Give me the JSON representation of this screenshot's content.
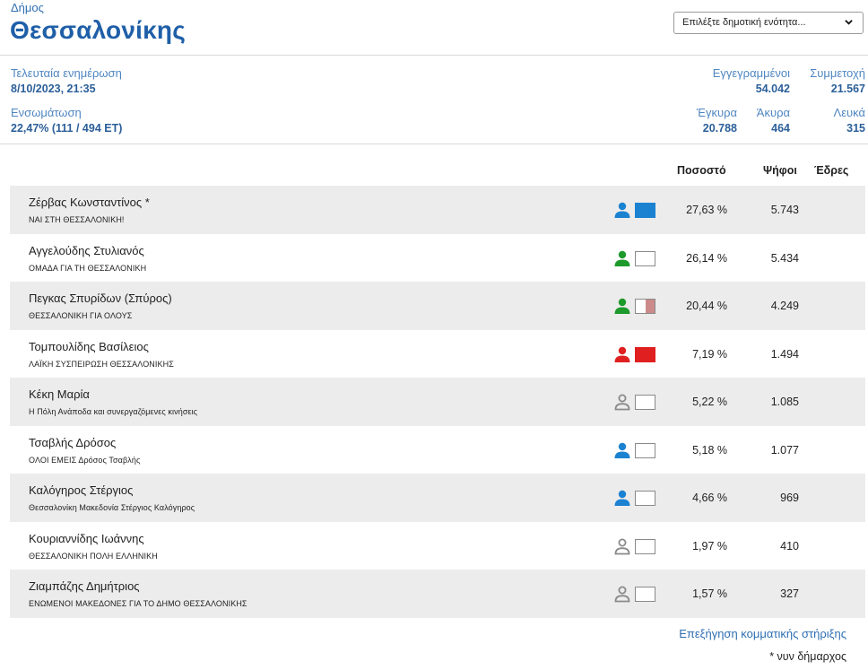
{
  "header": {
    "kicker": "Δήμος",
    "title": "Θεσσαλονίκης",
    "select_placeholder": "Επιλέξτε δημοτική ενότητα..."
  },
  "meta": {
    "updated_label": "Τελευταία ενημέρωση",
    "updated_value": "8/10/2023, 21:35",
    "integration_label": "Ενσωμάτωση",
    "integration_value": "22,47% (111 / 494 ΕΤ)",
    "registered_label": "Εγγεγραμμένοι",
    "registered_value": "54.042",
    "turnout_label": "Συμμετοχή",
    "turnout_value": "21.567",
    "valid_label": "Έγκυρα",
    "valid_value": "20.788",
    "invalid_label": "Άκυρα",
    "invalid_value": "464",
    "blank_label": "Λευκά",
    "blank_value": "315"
  },
  "table": {
    "col_percent": "Ποσοστό",
    "col_votes": "Ψήφοι",
    "col_seats": "Έδρες",
    "rows": [
      {
        "name": "Ζέρβας Κωνσταντίνος *",
        "party": "ΝΑΙ ΣΤΗ ΘΕΣΣΑΛΟΝΙΚΗ!",
        "percent": "27,63 %",
        "votes": "5.743",
        "icon": "person-icon",
        "icon_color": "#1b82d2",
        "support_color": "#1b82d2",
        "support_fill": 1.0
      },
      {
        "name": "Αγγελούδης Στυλιανός",
        "party": "ΟΜΑΔΑ ΓΙΑ ΤΗ ΘΕΣΣΑΛΟΝΙΚΗ",
        "percent": "26,14 %",
        "votes": "5.434",
        "icon": "person-icon",
        "icon_color": "#1e9a2c",
        "support_color": "#ffffff",
        "support_fill": 0.0
      },
      {
        "name": "Πεγκας Σπυρίδων (Σπύρος)",
        "party": "ΘΕΣΣΑΛΟΝΙΚΗ ΓΙΑ ΟΛΟΥΣ",
        "percent": "20,44 %",
        "votes": "4.249",
        "icon": "person-icon",
        "icon_color": "#1e9a2c",
        "support_color": "#cc8a8a",
        "support_fill": 0.5
      },
      {
        "name": "Τομπουλίδης Βασίλειος",
        "party": "ΛΑΪΚΗ ΣΥΣΠΕΙΡΩΣΗ ΘΕΣΣΑΛΟΝΙΚΗΣ",
        "percent": "7,19 %",
        "votes": "1.494",
        "icon": "person-icon",
        "icon_color": "#e02020",
        "support_color": "#e02020",
        "support_fill": 1.0
      },
      {
        "name": "Κέκη Μαρία",
        "party": "Η Πόλη Ανάποδα και συνεργαζόμενες κινήσεις",
        "percent": "5,22 %",
        "votes": "1.085",
        "icon": "person-outline-icon",
        "icon_color": "#8a8a8a",
        "support_color": "#ffffff",
        "support_fill": 0.0
      },
      {
        "name": "Τσαβλής Δρόσος",
        "party": "ΟΛΟΙ ΕΜΕΙΣ Δρόσος Τσαβλής",
        "percent": "5,18 %",
        "votes": "1.077",
        "icon": "person-icon",
        "icon_color": "#1b82d2",
        "support_color": "#ffffff",
        "support_fill": 0.0
      },
      {
        "name": "Καλόγηρος Στέργιος",
        "party": "Θεσσαλονίκη Μακεδονία Στέργιος Καλόγηρος",
        "percent": "4,66 %",
        "votes": "969",
        "icon": "person-icon",
        "icon_color": "#1b82d2",
        "support_color": "#ffffff",
        "support_fill": 0.0
      },
      {
        "name": "Κουριαννίδης Ιωάννης",
        "party": "ΘΕΣΣΑΛΟΝΙΚΗ ΠΟΛΗ ΕΛΛΗΝΙΚΗ",
        "percent": "1,97 %",
        "votes": "410",
        "icon": "person-outline-icon",
        "icon_color": "#8a8a8a",
        "support_color": "#ffffff",
        "support_fill": 0.0
      },
      {
        "name": "Ζιαμπάζης Δημήτριος",
        "party": "ΕΝΩΜΕΝΟΙ ΜΑΚΕΔΟΝΕΣ ΓΙΑ ΤΟ ΔΗΜΟ ΘΕΣΣΑΛΟΝΙΚΗΣ",
        "percent": "1,57 %",
        "votes": "327",
        "icon": "person-outline-icon",
        "icon_color": "#8a8a8a",
        "support_color": "#ffffff",
        "support_fill": 0.0
      }
    ]
  },
  "footer": {
    "explanation_link": "Επεξήγηση κομματικής στήριξης",
    "note": "* νυν δήμαρχος"
  }
}
